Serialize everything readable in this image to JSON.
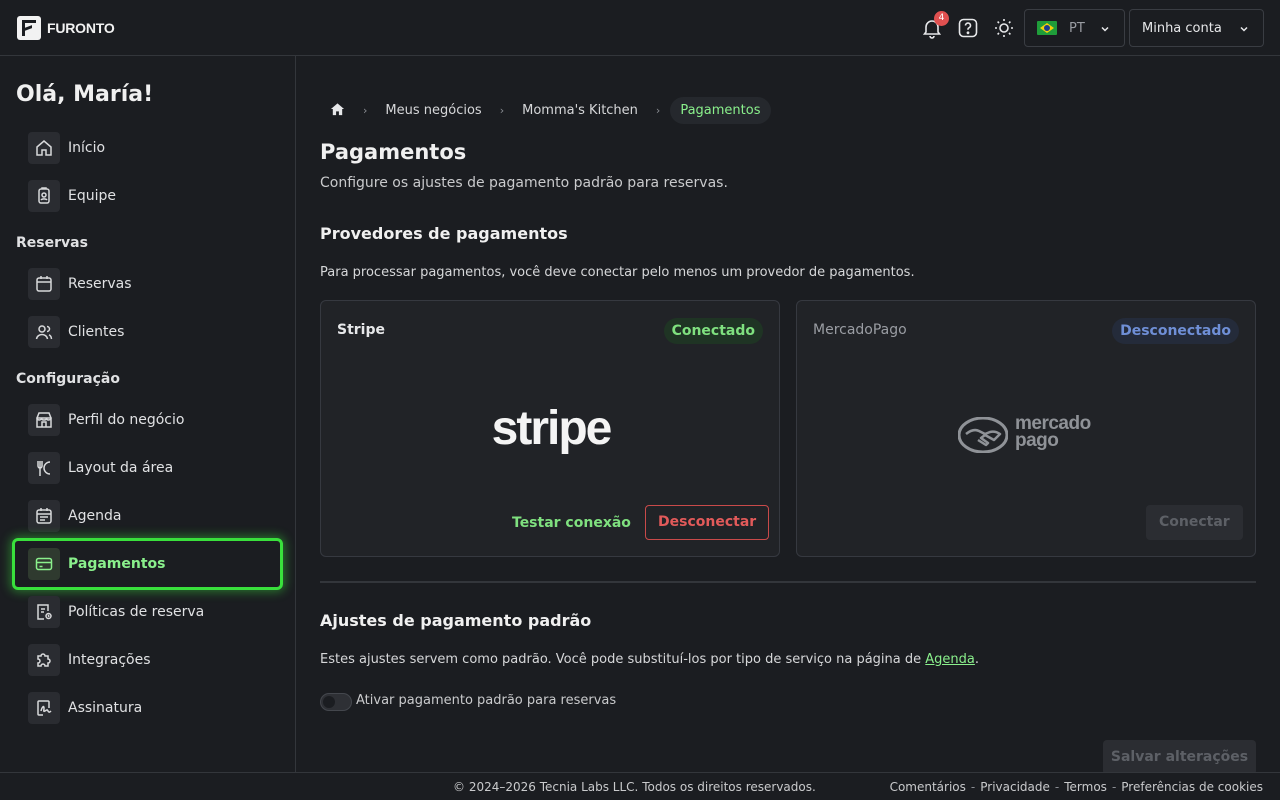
{
  "header": {
    "logo_text": "FURONTO",
    "notifications_count": "4",
    "language_code": "PT",
    "account_label": "Minha conta"
  },
  "sidebar": {
    "greeting": "Olá, María!",
    "top_items": [
      {
        "label": "Início",
        "icon": "home-icon"
      },
      {
        "label": "Equipe",
        "icon": "id-badge-icon"
      }
    ],
    "sections": [
      {
        "title": "Reservas",
        "items": [
          {
            "label": "Reservas",
            "icon": "calendar-icon"
          },
          {
            "label": "Clientes",
            "icon": "users-icon"
          }
        ]
      },
      {
        "title": "Configuração",
        "items": [
          {
            "label": "Perfil do negócio",
            "icon": "store-icon"
          },
          {
            "label": "Layout da área",
            "icon": "utensils-icon"
          },
          {
            "label": "Agenda",
            "icon": "schedule-icon"
          },
          {
            "label": "Pagamentos",
            "icon": "credit-card-icon",
            "active": true
          },
          {
            "label": "Políticas de reserva",
            "icon": "policy-icon"
          },
          {
            "label": "Integrações",
            "icon": "puzzle-icon"
          },
          {
            "label": "Assinatura",
            "icon": "signature-icon"
          }
        ]
      }
    ]
  },
  "breadcrumb": [
    "Meus negócios",
    "Momma's Kitchen",
    "Pagamentos"
  ],
  "page": {
    "title": "Pagamentos",
    "subtitle": "Configure os ajustes de pagamento padrão para reservas."
  },
  "providers": {
    "title": "Provedores de pagamentos",
    "description": "Para processar pagamentos, você deve conectar pelo menos um provedor de pagamentos.",
    "stripe": {
      "name": "Stripe",
      "status": "Conectado",
      "logo_text": "stripe",
      "test_label": "Testar conexão",
      "disconnect_label": "Desconectar"
    },
    "mercadopago": {
      "name": "MercadoPago",
      "status": "Desconectado",
      "logo_line1": "mercado",
      "logo_line2": "pago",
      "connect_label": "Conectar"
    }
  },
  "defaults": {
    "title": "Ajustes de pagamento padrão",
    "description_prefix": "Estes ajustes servem como padrão. Você pode substituí-los por tipo de serviço na página de ",
    "description_link": "Agenda",
    "description_suffix": ".",
    "toggle_label": "Ativar pagamento padrão para reservas",
    "toggle_on": false,
    "save_label": "Salvar alterações"
  },
  "footer": {
    "copyright": "© 2024–2026 Tecnia Labs LLC. Todos os direitos reservados.",
    "links": [
      "Comentários",
      "Privacidade",
      "Termos",
      "Preferências de cookies"
    ]
  },
  "colors": {
    "accent": "#8af08c",
    "active_outline": "#39e03c",
    "danger": "#e25a5a",
    "disconnected": "#6f8fd6"
  }
}
